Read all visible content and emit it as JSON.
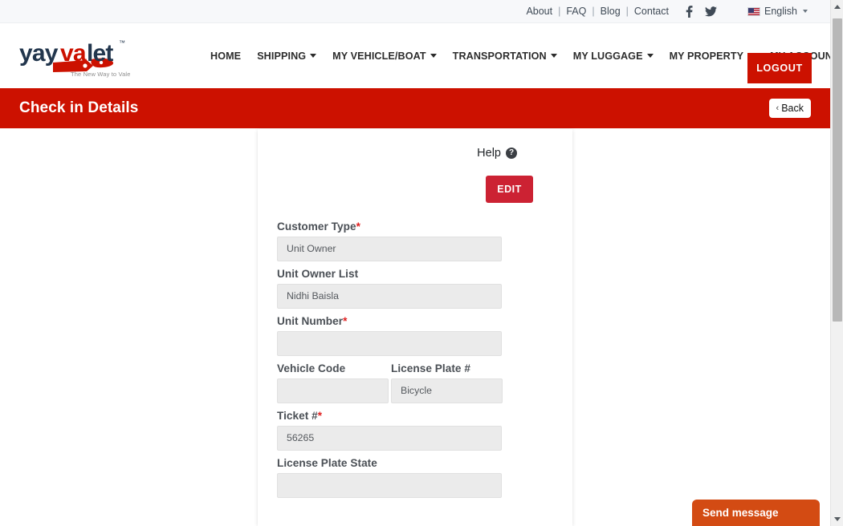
{
  "topbar": {
    "links": [
      "About",
      "FAQ",
      "Blog",
      "Contact"
    ],
    "separator": "|",
    "social": [
      "facebook-icon",
      "twitter-icon"
    ],
    "language": "English"
  },
  "logo": {
    "part1": "yay",
    "part2": "va",
    "part3": "let",
    "trademark": "™",
    "tagline": "The New Way to Valet"
  },
  "nav": {
    "items": [
      {
        "label": "HOME",
        "has_caret": false
      },
      {
        "label": "SHIPPING",
        "has_caret": true
      },
      {
        "label": "MY VEHICLE/BOAT",
        "has_caret": true
      },
      {
        "label": "TRANSPORTATION",
        "has_caret": true
      },
      {
        "label": "MY LUGGAGE",
        "has_caret": true
      },
      {
        "label": "MY PROPERTY",
        "has_caret": true
      },
      {
        "label": "MY ACCOUNT",
        "has_caret": true
      }
    ],
    "logout_label": "LOGOUT"
  },
  "banner": {
    "title": "Check in Details",
    "back_label": "Back",
    "back_chevron": "‹"
  },
  "card": {
    "help_label": "Help",
    "help_icon_glyph": "?",
    "edit_label": "EDIT",
    "fields": [
      {
        "label": "Customer Type",
        "required": true,
        "value": "Unit Owner"
      },
      {
        "label": "Unit Owner List",
        "required": false,
        "value": "Nidhi Baisla"
      },
      {
        "label": "Unit Number",
        "required": true,
        "value": ""
      }
    ],
    "two_col": [
      {
        "label": "Vehicle Code",
        "required": false,
        "value": ""
      },
      {
        "label": "License Plate #",
        "required": false,
        "value": "Bicycle"
      }
    ],
    "fields_after": [
      {
        "label": "Ticket #",
        "required": true,
        "value": "56265"
      },
      {
        "label": "License Plate State",
        "required": false,
        "value": ""
      }
    ],
    "required_marker": "*"
  },
  "chat": {
    "label": "Send message"
  },
  "colors": {
    "brand_red": "#cc1100",
    "edit_red": "#cc2233",
    "chat_orange": "#d34b13",
    "topbar_bg": "#f7f8fa",
    "field_bg": "#ebebeb",
    "label_gray": "#4a4f55",
    "logo_navy": "#1f3147"
  }
}
